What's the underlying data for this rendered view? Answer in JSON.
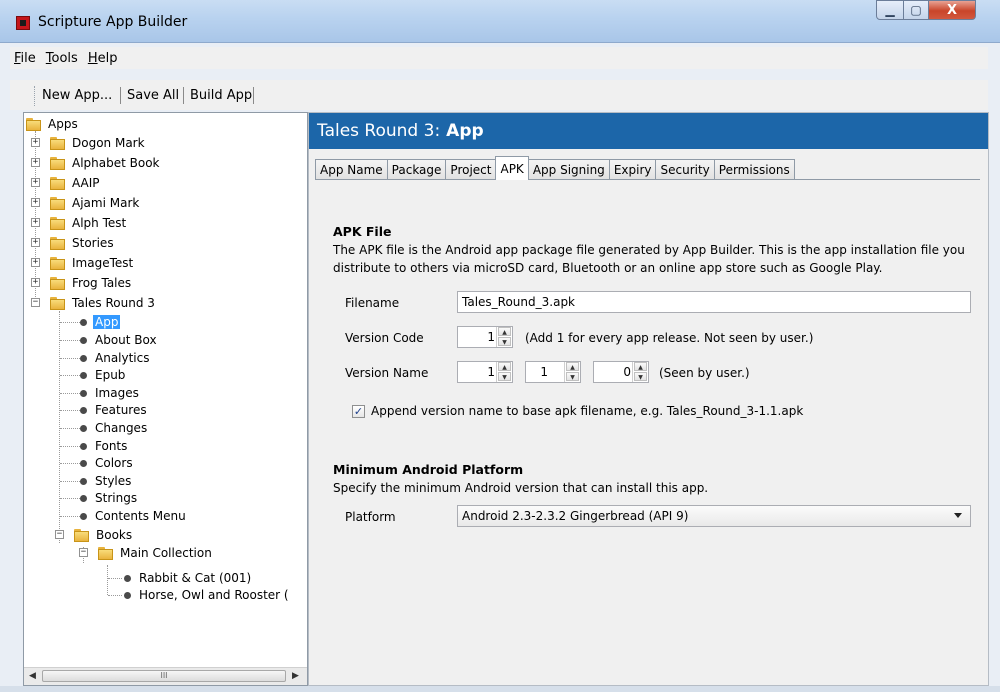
{
  "window": {
    "title": "Scripture App Builder",
    "controls": {
      "minimize": "▁",
      "maximize": "▢",
      "close": "X"
    }
  },
  "menu": [
    {
      "accel": "F",
      "rest": "ile"
    },
    {
      "accel": "T",
      "rest": "ools"
    },
    {
      "accel": "H",
      "rest": "elp"
    }
  ],
  "toolbar": {
    "new_app": "New App...",
    "save_all": "Save All",
    "build_app": "Build App"
  },
  "tree": {
    "root": "Apps",
    "apps": [
      "Dogon Mark",
      "Alphabet Book",
      "AAIP",
      "Ajami Mark",
      "Alph Test",
      "Stories",
      "ImageTest",
      "Frog Tales",
      "Tales Round 3"
    ],
    "expand_plus": "+",
    "expand_minus": "−",
    "settings": [
      "App",
      "About Box",
      "Analytics",
      "Epub",
      "Images",
      "Features",
      "Changes",
      "Fonts",
      "Colors",
      "Styles",
      "Strings",
      "Contents Menu"
    ],
    "books": "Books",
    "collection": "Main Collection",
    "book_items": [
      "Rabbit & Cat (001)",
      "Horse, Owl and Rooster ("
    ],
    "scroll": {
      "left": "◀",
      "right": "▶",
      "grip": "III"
    }
  },
  "panel": {
    "header_prefix": "Tales Round 3:",
    "header_bold": "App",
    "tabs": [
      "App Name",
      "Package",
      "Project",
      "APK",
      "App Signing",
      "Expiry",
      "Security",
      "Permissions"
    ],
    "active_tab": "APK",
    "apk": {
      "title": "APK File",
      "desc1": "The APK file is the Android app package file generated by App Builder. This is the app installation file you",
      "desc2": "distribute to others via microSD card, Bluetooth or an online app store such as Google Play.",
      "filename_label": "Filename",
      "filename_value": "Tales_Round_3.apk",
      "version_code_label": "Version Code",
      "version_code_value": "1",
      "version_code_hint": "(Add 1 for every app release. Not seen by user.)",
      "version_name_label": "Version Name",
      "version_name_major": "1",
      "version_name_minor": "1",
      "version_name_patch": "0",
      "version_name_hint": "(Seen by user.)",
      "append_checked": true,
      "append_label": "Append version name to base apk filename, e.g. Tales_Round_3-1.1.apk"
    },
    "platform": {
      "title": "Minimum Android Platform",
      "desc": "Specify the minimum Android version that can install this app.",
      "label": "Platform",
      "value": "Android 2.3-2.3.2 Gingerbread (API 9)"
    },
    "spin_up": "▲",
    "spin_down": "▼",
    "check_mark": "✓"
  }
}
